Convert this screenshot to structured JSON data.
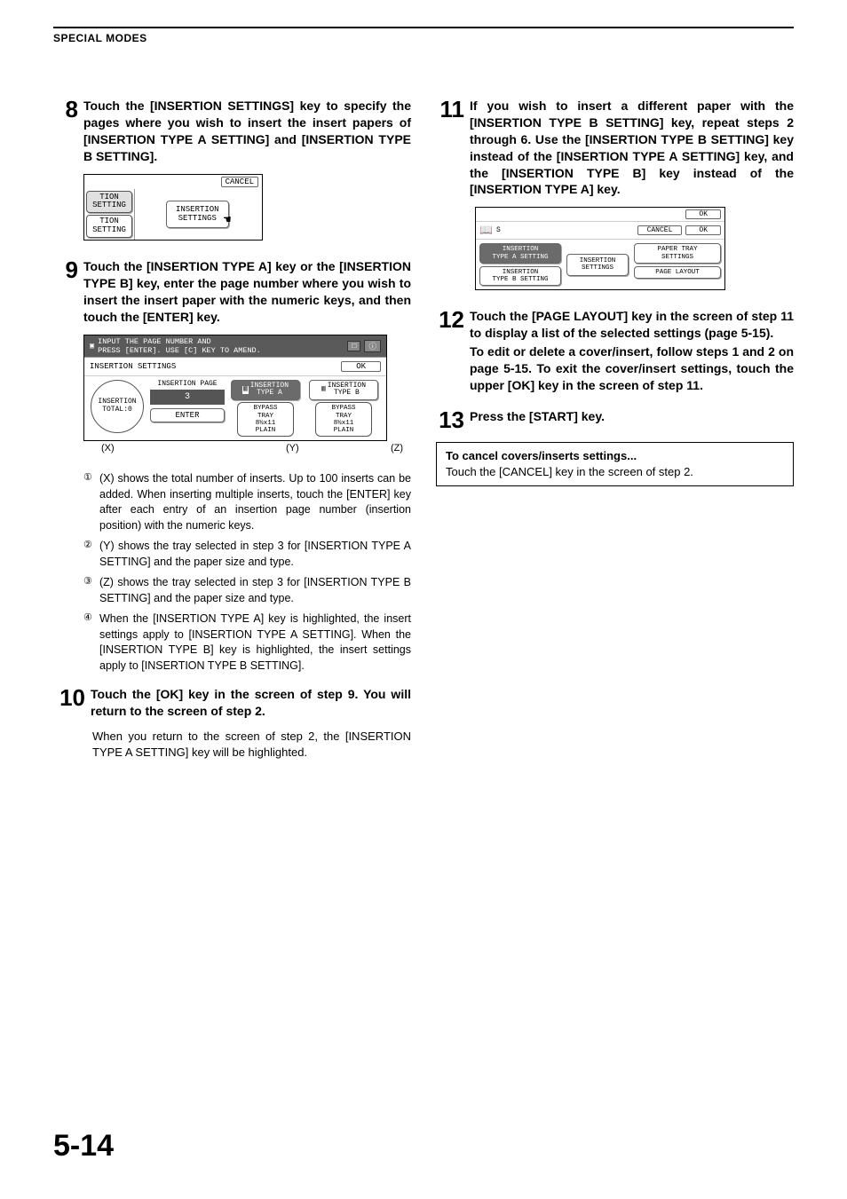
{
  "header": "SPECIAL MODES",
  "page_number": "5-14",
  "step8": {
    "num": "8",
    "title": "Touch the [INSERTION SETTINGS] key to specify the pages where you wish to insert the insert papers of [INSERTION TYPE A SETTING] and [INSERTION TYPE B SETTING].",
    "fig": {
      "cancel": "CANCEL",
      "left_top": "TION",
      "left_top2": "SETTING",
      "left_bot": "TION",
      "left_bot2": "SETTING",
      "button": "INSERTION\nSETTINGS"
    }
  },
  "step9": {
    "num": "9",
    "title": "Touch the [INSERTION TYPE A] key or the [INSERTION TYPE B] key, enter the page number where you wish to insert the insert paper with the numeric keys, and then touch the [ENTER] key.",
    "fig": {
      "prompt1": "INPUT THE PAGE NUMBER AND",
      "prompt2": "PRESS [ENTER]. USE [C] KEY TO AMEND.",
      "row_title": "INSERTION SETTINGS",
      "ok": "OK",
      "ins_total": "INSERTION\nTOTAL:0",
      "ins_page": "INSERTION PAGE",
      "page_val": "3",
      "enter": "ENTER",
      "typeA": "INSERTION\nTYPE A",
      "typeB": "INSERTION\nTYPE B",
      "trayA": "BYPASS\nTRAY\n8½x11\nPLAIN",
      "trayB": "BYPASS\nTRAY\n8½x11\nPLAIN",
      "x": "(X)",
      "y": "(Y)",
      "z": "(Z)"
    },
    "list": {
      "n1": "①",
      "t1": "(X) shows the total number of inserts. Up to 100 inserts can be added. When inserting multiple inserts, touch the [ENTER] key after each entry of an insertion page number (insertion position) with the numeric keys.",
      "n2": "②",
      "t2": "(Y) shows the tray selected in step 3 for [INSERTION TYPE A SETTING] and the paper size and type.",
      "n3": "③",
      "t3": "(Z) shows the tray selected in step 3 for [INSERTION TYPE B SETTING] and the paper size and type.",
      "n4": "④",
      "t4": "When the [INSERTION TYPE A] key is highlighted, the insert settings apply to [INSERTION TYPE A SETTING]. When the [INSERTION TYPE B] key is highlighted, the insert settings apply to [INSERTION TYPE B SETTING]."
    }
  },
  "step10": {
    "num": "10",
    "title": "Touch the [OK] key in the screen of step 9. You will return to the screen of step 2.",
    "body": "When you return to the screen of step 2, the [INSERTION TYPE A SETTING] key will be highlighted."
  },
  "step11": {
    "num": "11",
    "title": "If you wish to insert a different paper with the [INSERTION TYPE B SETTING] key, repeat steps 2 through 6. Use the [INSERTION TYPE B SETTING] key instead of the [INSERTION TYPE A SETTING] key, and the [INSERTION TYPE B] key instead of the [INSERTION TYPE A] key.",
    "fig": {
      "ok_top": "OK",
      "cancel": "CANCEL",
      "ok": "OK",
      "typeA": "INSERTION\nTYPE A SETTING",
      "typeB": "INSERTION\nTYPE B SETTING",
      "ins_set": "INSERTION\nSETTINGS",
      "paper": "PAPER TRAY\nSETTINGS",
      "layout": "PAGE LAYOUT"
    }
  },
  "step12": {
    "num": "12",
    "title": "Touch the [PAGE LAYOUT] key in the screen of step 11 to display a list of the selected settings (page 5-15).",
    "body": "To edit or delete a cover/insert, follow steps 1 and 2 on page 5-15. To exit the cover/insert settings, touch the upper [OK] key in the screen of step 11."
  },
  "step13": {
    "num": "13",
    "title": "Press the [START] key."
  },
  "cancel_box": {
    "title": "To cancel covers/inserts settings...",
    "body": "Touch the [CANCEL] key in the screen of step 2."
  }
}
